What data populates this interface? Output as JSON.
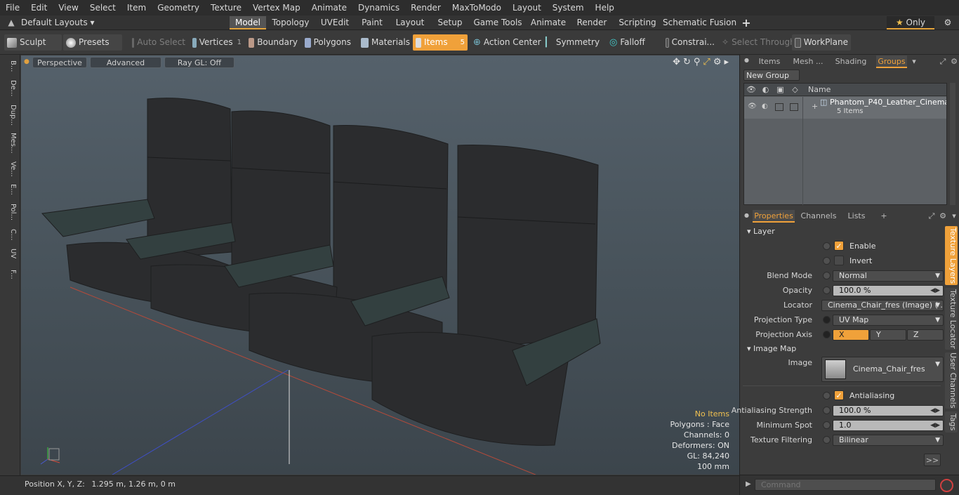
{
  "menu": [
    "File",
    "Edit",
    "View",
    "Select",
    "Item",
    "Geometry",
    "Texture",
    "Vertex Map",
    "Animate",
    "Dynamics",
    "Render",
    "MaxToModo",
    "Layout",
    "System",
    "Help"
  ],
  "layout_selector": "Default Layouts",
  "layout_tabs": [
    "Model",
    "Topology",
    "UVEdit",
    "Paint",
    "Layout",
    "Setup",
    "Game Tools",
    "Animate",
    "Render",
    "Scripting",
    "Schematic Fusion"
  ],
  "only_label": "Only",
  "toolbar": {
    "sculpt": "Sculpt",
    "presets": "Presets",
    "auto_select": "Auto Select",
    "vertices": "Vertices",
    "vertices_count": "1",
    "boundary": "Boundary",
    "polygons": "Polygons",
    "materials": "Materials",
    "items": "Items",
    "items_count": "5",
    "action_center": "Action Center",
    "symmetry": "Symmetry",
    "falloff": "Falloff",
    "constraints": "Constrai...",
    "select_through": "Select Through",
    "workplane": "WorkPlane"
  },
  "left_tabs": [
    "B...",
    "De...",
    "Dup...",
    "Mes...",
    "Ve...",
    "E...",
    "Pol...",
    "C...",
    "UV",
    "F..."
  ],
  "viewport": {
    "view_mode": "Perspective",
    "shading": "Advanced",
    "ray_gl": "Ray GL: Off",
    "info": {
      "no_items": "No Items",
      "polygons": "Polygons : Face",
      "channels": "Channels: 0",
      "deformers": "Deformers: ON",
      "gl": "GL: 84,240",
      "unit": "100 mm"
    }
  },
  "status": {
    "label": "Position X, Y, Z:",
    "value": "1.295 m, 1.26 m, 0 m"
  },
  "groups_panel": {
    "tabs": [
      "Items",
      "Mesh ...",
      "Shading",
      "Groups"
    ],
    "new_group": "New Group",
    "name_header": "Name",
    "group_name": "Phantom_P40_Leather_Cinema...",
    "group_count": "5 Items"
  },
  "properties_panel": {
    "tabs": [
      "Properties",
      "Channels",
      "Lists"
    ],
    "layer_section": "Layer",
    "enable": "Enable",
    "invert": "Invert",
    "blend_mode_label": "Blend Mode",
    "blend_mode": "Normal",
    "opacity_label": "Opacity",
    "opacity": "100.0 %",
    "locator_label": "Locator",
    "locator": "Cinema_Chair_fres (Image) ( ...",
    "projection_type_label": "Projection Type",
    "projection_type": "UV Map",
    "projection_axis_label": "Projection Axis",
    "axis_x": "X",
    "axis_y": "Y",
    "axis_z": "Z",
    "image_map_section": "Image Map",
    "image_label": "Image",
    "image_value": "Cinema_Chair_fres",
    "antialiasing": "Antialiasing",
    "aa_strength_label": "Antialiasing Strength",
    "aa_strength": "100.0 %",
    "min_spot_label": "Minimum Spot",
    "min_spot": "1.0",
    "tex_filter_label": "Texture Filtering",
    "tex_filter": "Bilinear",
    "more": ">>"
  },
  "side_tabs": [
    "Texture Layers",
    "Texture Locator",
    "User Channels",
    "Tags"
  ],
  "command_placeholder": "Command",
  "accent_color": "#f0a13a"
}
